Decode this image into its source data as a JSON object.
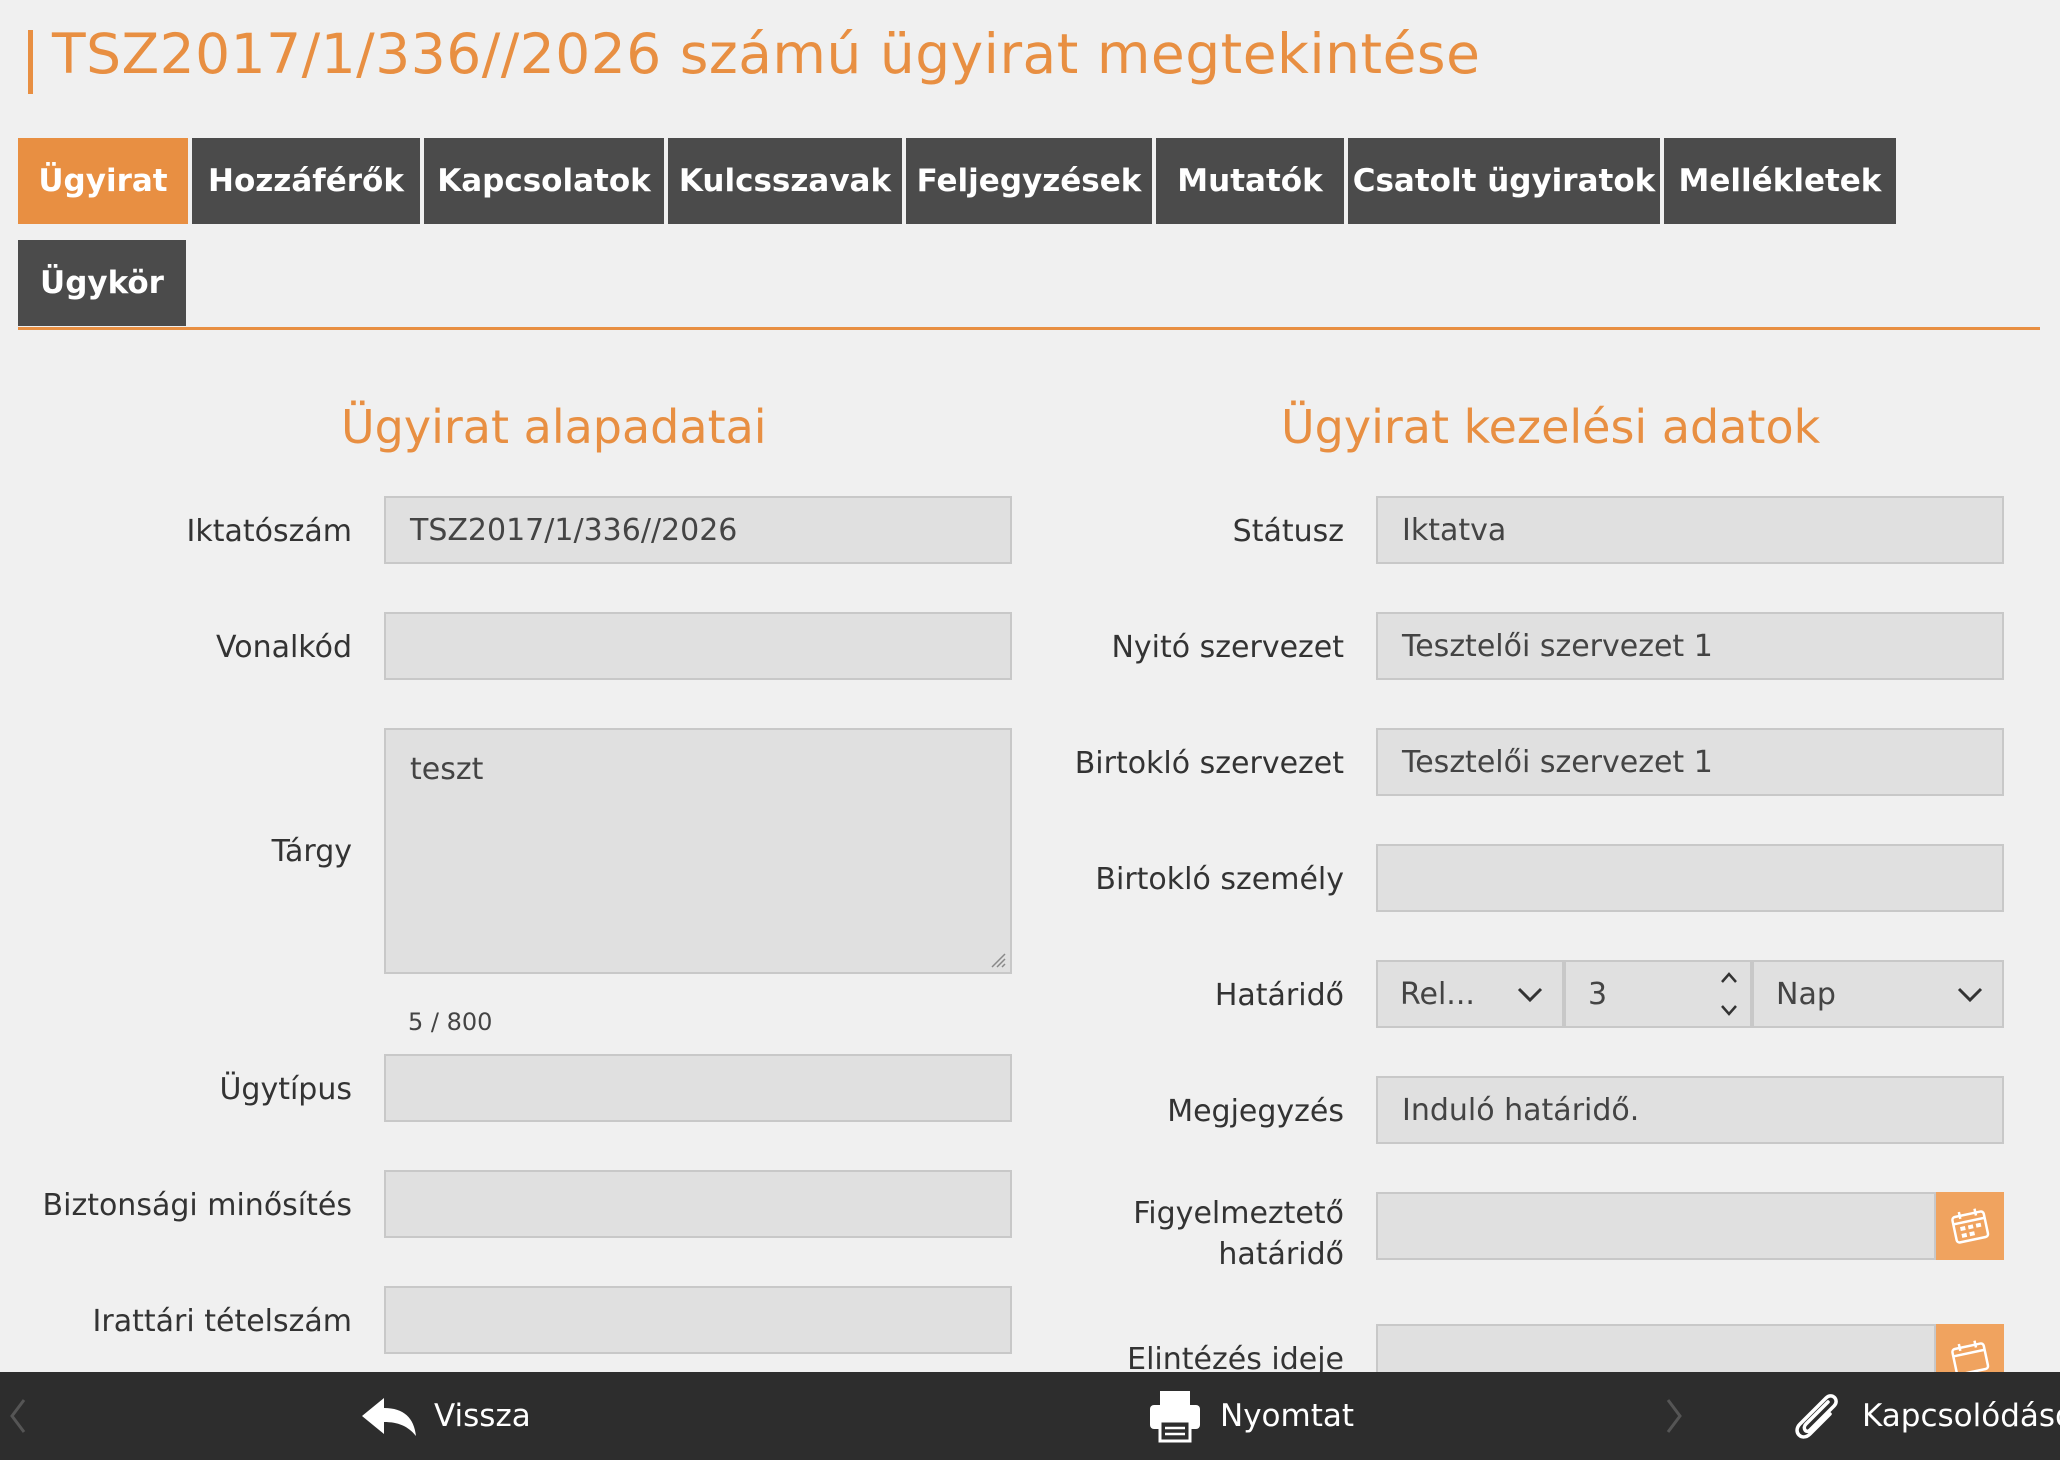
{
  "page": {
    "title": "TSZ2017/1/336//2026 számú ügyirat megtekintése"
  },
  "tabs": [
    {
      "label": "Ügyirat",
      "active": true
    },
    {
      "label": "Hozzáférők"
    },
    {
      "label": "Kapcsolatok"
    },
    {
      "label": "Kulcsszavak"
    },
    {
      "label": "Feljegyzések"
    },
    {
      "label": "Mutatók"
    },
    {
      "label": "Csatolt ügyiratok"
    },
    {
      "label": "Mellékletek"
    },
    {
      "label": "Ügykör"
    }
  ],
  "left": {
    "section_title": "Ügyirat alapadatai",
    "fields": {
      "iktatoszam": {
        "label": "Iktatószám",
        "value": "TSZ2017/1/336//2026"
      },
      "vonalkod": {
        "label": "Vonalkód",
        "value": ""
      },
      "targy": {
        "label": "Tárgy",
        "value": "teszt",
        "counter": "5 / 800"
      },
      "ugytipus": {
        "label": "Ügytípus",
        "value": ""
      },
      "biztonsagi": {
        "label": "Biztonsági minősítés",
        "value": ""
      },
      "irattari": {
        "label": "Irattári tételszám",
        "value": ""
      }
    }
  },
  "right": {
    "section_title": "Ügyirat kezelési adatok",
    "fields": {
      "statusz": {
        "label": "Státusz",
        "value": "Iktatva"
      },
      "nyito": {
        "label": "Nyitó szervezet",
        "value": "Tesztelői szervezet 1"
      },
      "birtoklo_szervezet": {
        "label": "Birtokló szervezet",
        "value": "Tesztelői szervezet 1"
      },
      "birtoklo_szemely": {
        "label": "Birtokló személy",
        "value": ""
      },
      "hatarido": {
        "label": "Határidő",
        "type_value": "Rel...",
        "number_value": "3",
        "unit_value": "Nap"
      },
      "megjegyzes": {
        "label": "Megjegyzés",
        "value": "Induló határidő."
      },
      "figyelmezteto": {
        "label_line1": "Figyelmeztető",
        "label_line2": "határidő",
        "value": ""
      },
      "elintezes": {
        "label": "Elintézés ideje",
        "value": ""
      }
    }
  },
  "bottom_bar": {
    "back_label": "Vissza",
    "print_label": "Nyomtat",
    "related_label": "Kapcsolódások"
  },
  "colors": {
    "accent": "#e88f42",
    "tab_dark": "#4b4b4b",
    "bottom_bar": "#2d2d2d"
  }
}
